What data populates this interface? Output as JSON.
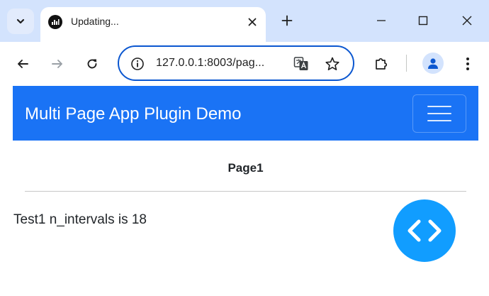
{
  "browser": {
    "tab": {
      "title": "Updating..."
    },
    "address_bar": {
      "url": "127.0.0.1:8003/pag..."
    }
  },
  "app": {
    "navbar": {
      "brand": "Multi Page App Plugin Demo"
    },
    "page_title": "Page1",
    "content": {
      "text": "Test1 n_intervals is 18"
    }
  },
  "colors": {
    "navbar_bg": "#1a73f5",
    "fab_bg": "#119dff",
    "tabstrip_bg": "#d3e3fd",
    "omnibox_border": "#0b57d0"
  },
  "icons": {
    "tab_search": "chevron-down-icon",
    "favicon": "bar-chart-icon",
    "tab_close": "close-icon",
    "new_tab": "plus-icon",
    "minimize": "minimize-icon",
    "maximize": "maximize-icon",
    "window_close": "close-icon",
    "back": "arrow-left-icon",
    "forward": "arrow-right-icon",
    "reload": "reload-icon",
    "site_info": "info-icon",
    "translate": "translate-icon",
    "bookmark": "star-icon",
    "extensions": "puzzle-icon",
    "profile": "person-icon",
    "menu": "more-vert-icon",
    "navbar_toggler": "hamburger-icon",
    "dev_tools": "code-icon"
  }
}
